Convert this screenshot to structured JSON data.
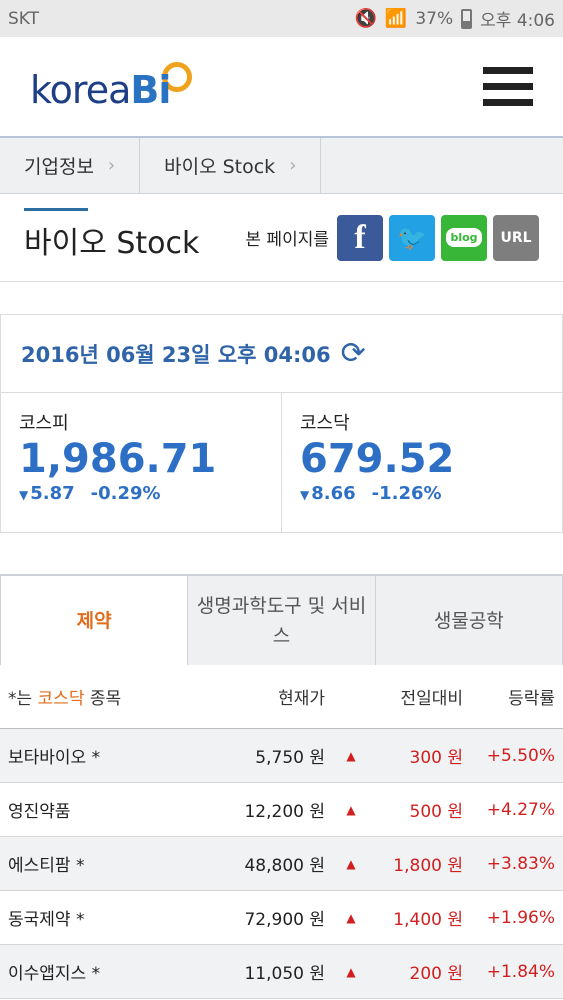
{
  "status": {
    "carrier": "SKT",
    "battery": "37%",
    "time": "오후 4:06"
  },
  "brand": {
    "korea": "korea",
    "bio": "Bi"
  },
  "breadcrumb": [
    "기업정보",
    "바이오 Stock"
  ],
  "page": {
    "title": "바이오 Stock",
    "share_label": "본 페이지를",
    "blog_label": "blog",
    "url_label": "URL",
    "fb_glyph": "f"
  },
  "date": "2016년 06월 23일 오후 04:06",
  "indices": [
    {
      "name": "코스피",
      "value": "1,986.71",
      "change": "5.87",
      "rate": "-0.29%"
    },
    {
      "name": "코스닥",
      "value": "679.52",
      "change": "8.66",
      "rate": "-1.26%"
    }
  ],
  "tabs": [
    "제약",
    "생명과학도구 및 서비스",
    "생물공학"
  ],
  "table": {
    "note_prefix": "*는 ",
    "note_highlight": "코스닥",
    "note_suffix": " 종목",
    "headers": {
      "price": "현재가",
      "change": "전일대비",
      "rate": "등락률"
    },
    "rows": [
      {
        "name": "보타바이오 *",
        "price": "5,750 원",
        "change": "300 원",
        "rate": "+5.50%"
      },
      {
        "name": "영진약품",
        "price": "12,200 원",
        "change": "500 원",
        "rate": "+4.27%"
      },
      {
        "name": "에스티팜 *",
        "price": "48,800 원",
        "change": "1,800 원",
        "rate": "+3.83%"
      },
      {
        "name": "동국제약 *",
        "price": "72,900 원",
        "change": "1,400 원",
        "rate": "+1.96%"
      },
      {
        "name": "이수앱지스 *",
        "price": "11,050 원",
        "change": "200 원",
        "rate": "+1.84%"
      }
    ]
  },
  "colors": {
    "accent_blue": "#2d6fc4",
    "accent_orange": "#e16c1b",
    "up_red": "#d11f1f"
  }
}
